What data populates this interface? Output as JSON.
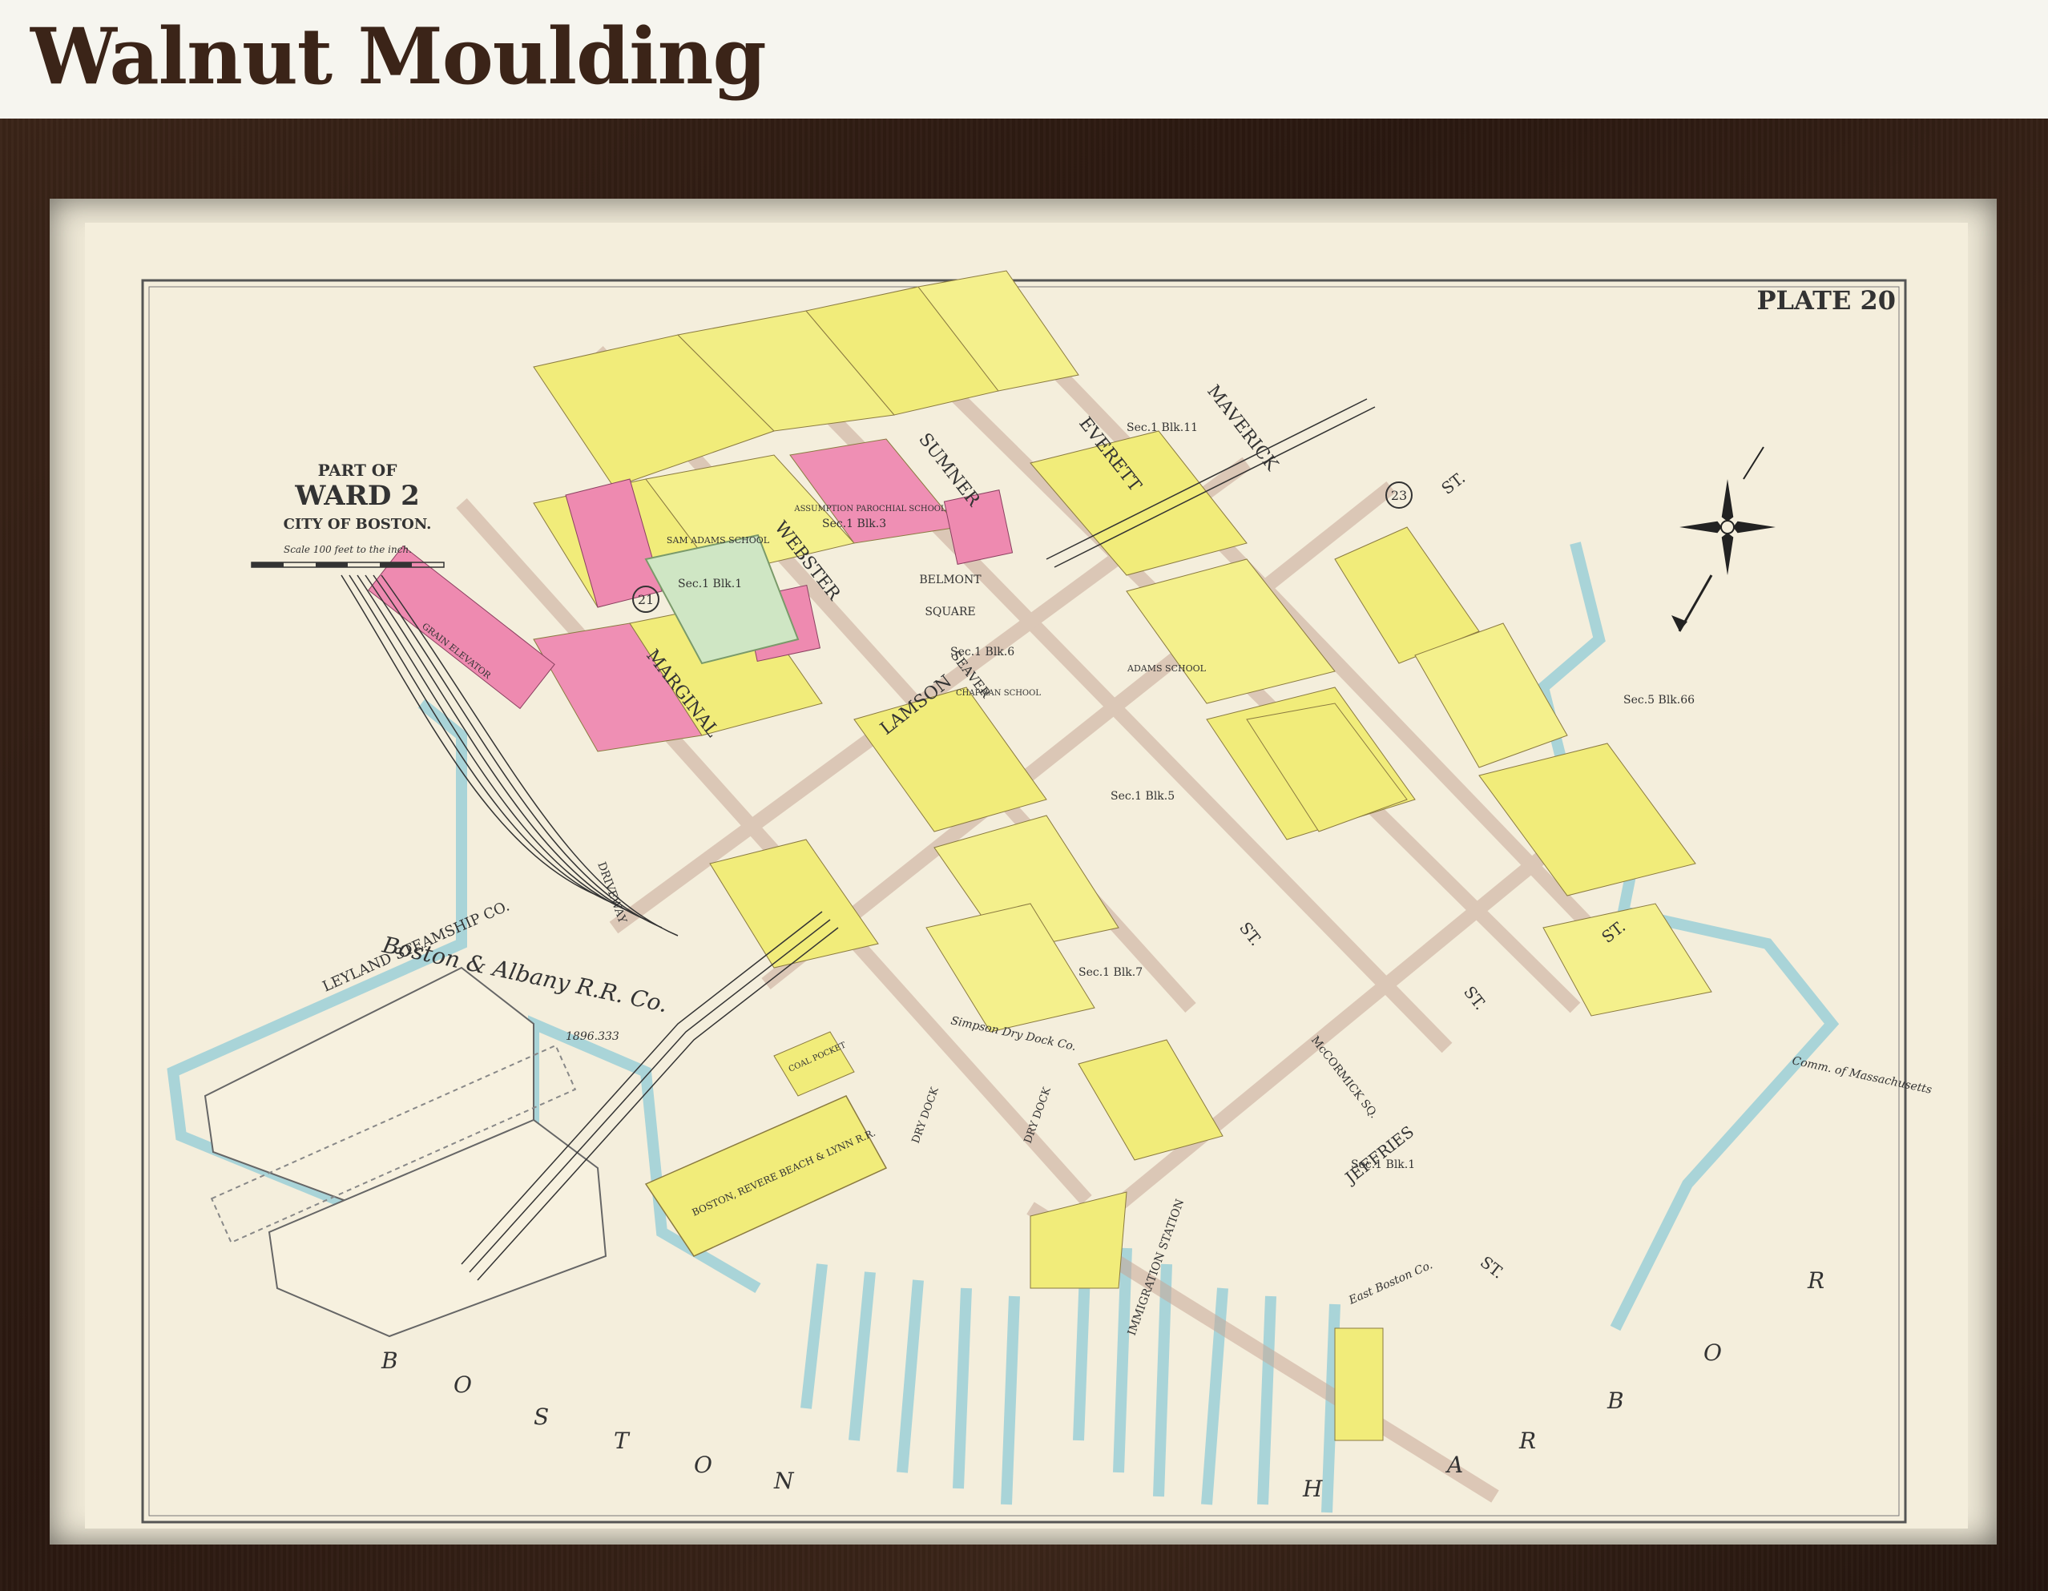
{
  "header": {
    "title": "Walnut Moulding"
  },
  "map": {
    "plate": "PLATE 20",
    "title_lines": [
      "PART OF",
      "WARD 2",
      "CITY OF BOSTON."
    ],
    "scale_text": "Scale 100 feet to the inch.",
    "ward_numbers": [
      "21",
      "23"
    ],
    "streets": [
      "MAVERICK",
      "EVERETT",
      "SUMNER",
      "WEBSTER",
      "MARGINAL",
      "LAMSON",
      "SEAVER",
      "ST.",
      "ST.",
      "ST.",
      "ST.",
      "JEFFRIES",
      "ST.",
      "McCORMICK SQ."
    ],
    "square": [
      "BELMONT",
      "SQUARE"
    ],
    "areas": {
      "leyland": "LEYLAND STEAMSHIP CO.",
      "railroad": "Boston & Albany R.R. Co.",
      "railroad_value": "1896.333",
      "driveway": "DRIVEWAY",
      "brevere": "BOSTON, REVERE BEACH & LYNN R.R.",
      "simpson": "Simpson Dry Dock Co.",
      "dry_dock1": "DRY DOCK",
      "dry_dock2": "DRY DOCK",
      "immigration": "IMMIGRATION STATION",
      "east_boston": "East Boston Co.",
      "comm_mass": "Comm. of Massachusetts",
      "harbor_letters": [
        "B",
        "O",
        "S",
        "T",
        "O",
        "N",
        "H",
        "A",
        "R",
        "B",
        "O",
        "R"
      ],
      "schools": [
        "SAM ADAMS SCHOOL",
        "ADAMS SCHOOL",
        "ASSUMPTION PAROCHIAL SCHOOL",
        "CHAPMAN SCHOOL"
      ],
      "grain_elevator": "GRAIN ELEVATOR",
      "coal_pocket": "COAL POCKET"
    },
    "sections": [
      "Sec.1 Blk.1",
      "Sec.1 Blk.3",
      "Sec.1 Blk.5",
      "Sec.1 Blk.6",
      "Sec.1 Blk.7",
      "Sec.1 Blk.11",
      "Sec.5 Blk.66",
      "Sec.1 Blk.1"
    ]
  }
}
